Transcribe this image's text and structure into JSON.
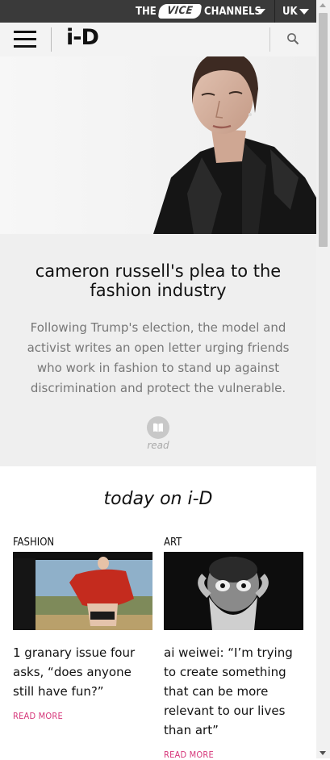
{
  "vice_bar": {
    "the_label": "THE",
    "logo_text": "VICE",
    "channels_label": "CHANNELS",
    "region_label": "UK"
  },
  "header": {
    "logo_text": "i-D"
  },
  "hero_article": {
    "title": "cameron russell's plea to the fashion industry",
    "description": "Following Trump's election, the model and activist writes an open letter urging friends who work in fashion to stand up against discrimination and protect the vulnerable.",
    "read_label": "read"
  },
  "today": {
    "heading": "today on i-D",
    "articles": [
      {
        "category": "FASHION",
        "headline": "1 granary issue four asks, “does anyone still have fun?”",
        "read_more": "READ MORE"
      },
      {
        "category": "ART",
        "headline": "ai weiwei: “I’m trying to create something that can be more relevant to our lives than art”",
        "read_more": "READ MORE"
      }
    ]
  },
  "colors": {
    "vice_bar": "#3a3a3a",
    "header_bg": "#f3f3f3",
    "card_bg": "#efefef",
    "read_more": "#d6377a"
  },
  "icons": {
    "menu": "hamburger-icon",
    "search": "search-icon",
    "read": "book-icon",
    "dropdown": "caret-down-icon"
  }
}
